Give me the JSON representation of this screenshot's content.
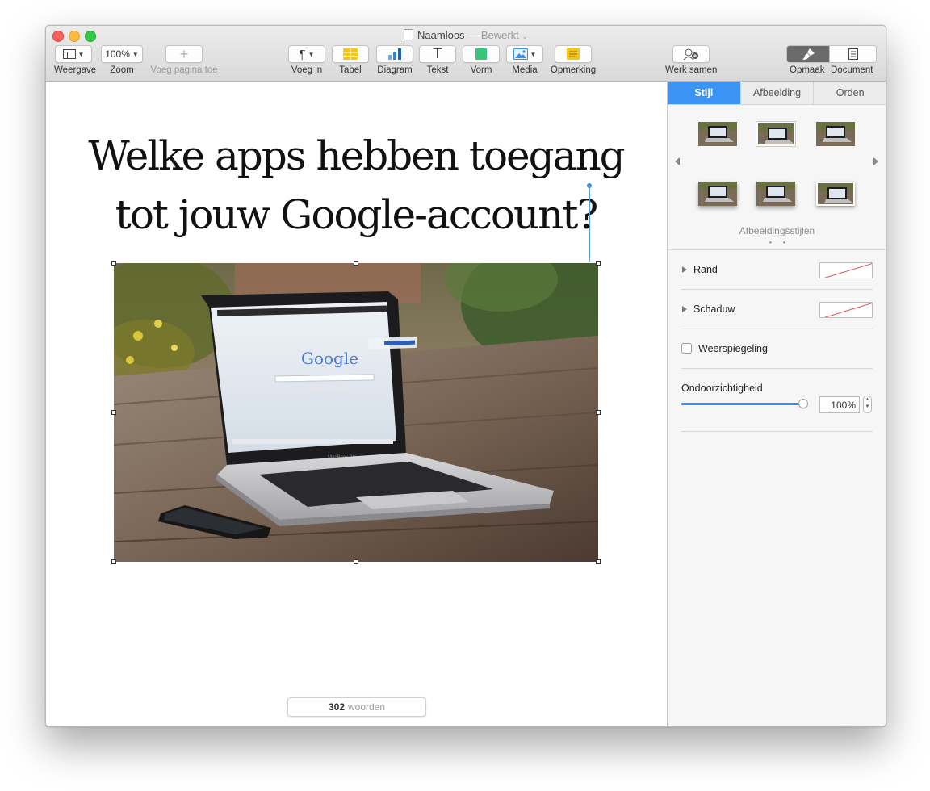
{
  "window": {
    "title": "Naamloos",
    "title_separator": "—",
    "status": "Bewerkt",
    "status_chevron": "⌄"
  },
  "toolbar": {
    "view": {
      "label": "Weergave",
      "icon": "sidebar-view-icon"
    },
    "zoom": {
      "label": "Zoom",
      "value": "100%"
    },
    "add_page": {
      "label": "Voeg pagina toe",
      "icon": "+",
      "enabled": false
    },
    "insert": {
      "label": "Voeg in",
      "icon": "¶"
    },
    "table": {
      "label": "Tabel",
      "icon": "table-icon",
      "color": "#f5c518"
    },
    "chart": {
      "label": "Diagram",
      "icon": "bar-chart-icon",
      "color": "#2f7fe0"
    },
    "text": {
      "label": "Tekst",
      "icon": "T"
    },
    "shape": {
      "label": "Vorm",
      "icon": "square-icon",
      "color": "#34c77b"
    },
    "media": {
      "label": "Media",
      "icon": "photo-icon",
      "color": "#3a8ee6"
    },
    "comment": {
      "label": "Opmerking",
      "icon": "note-icon",
      "color": "#f5c518"
    },
    "collaborate": {
      "label": "Werk samen",
      "icon": "add-person-icon"
    },
    "format": {
      "label": "Opmaak",
      "icon": "paintbrush-icon",
      "active": true
    },
    "document": {
      "label": "Document",
      "icon": "document-icon"
    }
  },
  "document": {
    "headline_line1": "Welke apps hebben toegang",
    "headline_line2": "tot jouw Google-account?",
    "image": {
      "screen_logo": "Google",
      "laptop_brand": "MacBook Pro"
    },
    "word_count": "302",
    "word_count_label": "woorden"
  },
  "sidebar": {
    "tabs": [
      {
        "label": "Stijl",
        "active": true
      },
      {
        "label": "Afbeelding",
        "active": false
      },
      {
        "label": "Orden",
        "active": false
      }
    ],
    "styles_label": "Afbeeldingsstijlen",
    "styles_page_dots": "• •",
    "border_label": "Rand",
    "shadow_label": "Schaduw",
    "reflection_label": "Weerspiegeling",
    "reflection_checked": false,
    "opacity_label": "Ondoorzichtigheid",
    "opacity_value": "100%",
    "opacity_fraction": 1.0,
    "accent_color": "#3b94f5"
  }
}
